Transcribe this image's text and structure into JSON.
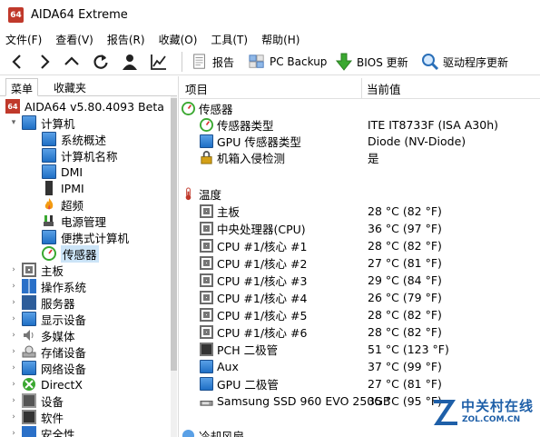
{
  "window": {
    "title": "AIDA64 Extreme",
    "app_icon_text": "64"
  },
  "menu": [
    "文件(F)",
    "查看(V)",
    "报告(R)",
    "收藏(O)",
    "工具(T)",
    "帮助(H)"
  ],
  "toolbar": {
    "report": "报告",
    "pc_backup": "PC Backup",
    "bios_update": "BIOS 更新",
    "driver_update": "驱动程序更新"
  },
  "tabs": {
    "menu": "菜单",
    "favorites": "收藏夹"
  },
  "tree": {
    "root": "AIDA64 v5.80.4093 Beta",
    "computer": "计算机",
    "computer_children": [
      "系统概述",
      "计算机名称",
      "DMI",
      "IPMI",
      "超频",
      "电源管理",
      "便携式计算机",
      "传感器"
    ],
    "categories": [
      "主板",
      "操作系统",
      "服务器",
      "显示设备",
      "多媒体",
      "存储设备",
      "网络设备",
      "DirectX",
      "设备",
      "软件",
      "安全性"
    ]
  },
  "columns": {
    "item": "项目",
    "value": "当前值"
  },
  "sections": {
    "sensor": {
      "title": "传感器",
      "rows": [
        {
          "name": "传感器类型",
          "value": "ITE IT8733F  (ISA A30h)"
        },
        {
          "name": "GPU 传感器类型",
          "value": "Diode  (NV-Diode)"
        },
        {
          "name": "机箱入侵检测",
          "value": "是"
        }
      ]
    },
    "temperature": {
      "title": "温度",
      "rows": [
        {
          "name": "主板",
          "value": "28 °C  (82 °F)"
        },
        {
          "name": "中央处理器(CPU)",
          "value": "36 °C  (97 °F)"
        },
        {
          "name": "CPU #1/核心 #1",
          "value": "28 °C  (82 °F)"
        },
        {
          "name": "CPU #1/核心 #2",
          "value": "27 °C  (81 °F)"
        },
        {
          "name": "CPU #1/核心 #3",
          "value": "29 °C  (84 °F)"
        },
        {
          "name": "CPU #1/核心 #4",
          "value": "26 °C  (79 °F)"
        },
        {
          "name": "CPU #1/核心 #5",
          "value": "28 °C  (82 °F)"
        },
        {
          "name": "CPU #1/核心 #6",
          "value": "28 °C  (82 °F)"
        },
        {
          "name": "PCH 二极管",
          "value": "51 °C  (123 °F)"
        },
        {
          "name": "Aux",
          "value": "37 °C  (99 °F)"
        },
        {
          "name": "GPU 二极管",
          "value": "27 °C  (81 °F)"
        },
        {
          "name": "Samsung SSD 960 EVO 250GB",
          "value": "35 °C  (95 °F)"
        }
      ]
    },
    "cooling": {
      "title": "冷却风扇"
    }
  },
  "watermark": {
    "cn": "中关村在线",
    "en": "ZOL.COM.CN"
  }
}
